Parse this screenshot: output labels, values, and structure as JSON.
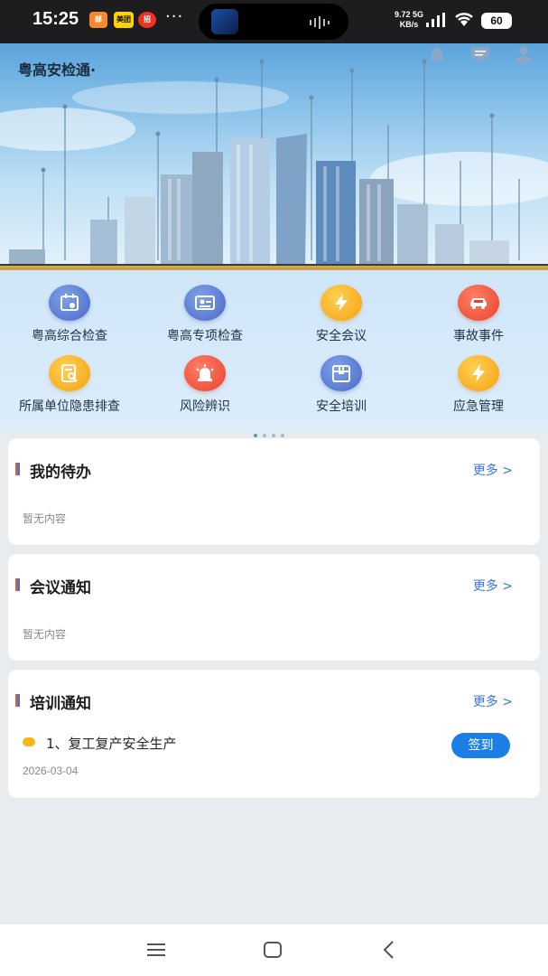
{
  "status_bar": {
    "time": "15:25",
    "app_badges": [
      "邮",
      "美团",
      "招"
    ],
    "more": "···",
    "speed_value": "9.72",
    "speed_unit": "KB/s",
    "network": "5G",
    "battery": "60"
  },
  "header": {
    "app_title": "粤高安检通·",
    "icons": [
      "bell-icon",
      "message-icon",
      "user-icon"
    ]
  },
  "functions": [
    {
      "label": "粤高综合检查",
      "icon": "calendar-check-icon",
      "color": "blue"
    },
    {
      "label": "粤高专项检查",
      "icon": "id-card-icon",
      "color": "blue"
    },
    {
      "label": "安全会议",
      "icon": "lightning-icon",
      "color": "orange"
    },
    {
      "label": "事故事件",
      "icon": "car-accident-icon",
      "color": "red"
    },
    {
      "label": "所属单位隐患排查",
      "icon": "document-search-icon",
      "color": "orange"
    },
    {
      "label": "风险辨识",
      "icon": "alarm-light-icon",
      "color": "red"
    },
    {
      "label": "安全培训",
      "icon": "box-icon",
      "color": "blue"
    },
    {
      "label": "应急管理",
      "icon": "lightning-icon",
      "color": "orange"
    }
  ],
  "pager": {
    "pages": 4,
    "active": 1
  },
  "todo": {
    "title": "我的待办",
    "more": "更多 >",
    "empty": "暂无内容"
  },
  "meeting": {
    "title": "会议通知",
    "more": "更多 >",
    "empty": "暂无内容"
  },
  "training": {
    "title": "培训通知",
    "more": "更多 >",
    "items": [
      {
        "title": "1、复工复产安全生产",
        "date": "2026-03-04",
        "action": "签到"
      }
    ]
  },
  "nav": [
    "menu-icon",
    "home-icon",
    "back-icon"
  ],
  "colors": {
    "accent": "#1b7ee6",
    "more_link": "#3c78c8",
    "status_bar": "#1d1d1f",
    "page_bg": "#e9ecef"
  }
}
